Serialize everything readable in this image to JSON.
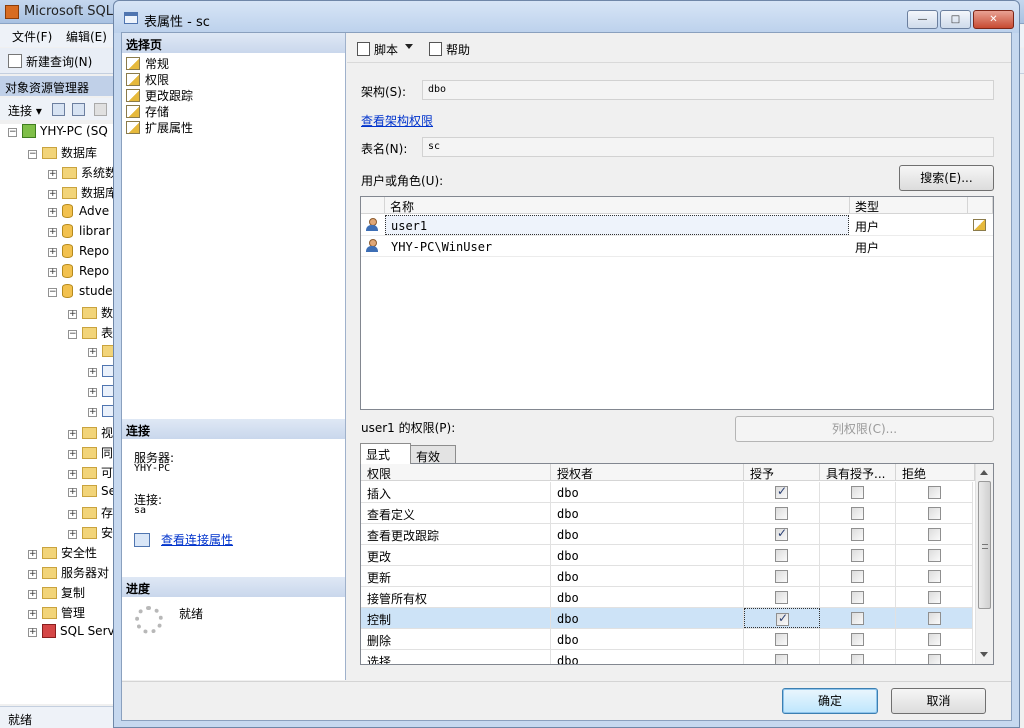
{
  "background_app": {
    "title": "Microsoft SQL",
    "menu": [
      "文件(F)",
      "编辑(E)"
    ],
    "toolbar_new_query": "新建查询(N)",
    "object_explorer_title": "对象资源管理器",
    "connect_label": "连接",
    "tree": [
      {
        "label": "YHY-PC (SQ",
        "level": 0,
        "icon": "server",
        "expander": "−"
      },
      {
        "label": "数据库",
        "level": 1,
        "icon": "folder",
        "expander": "−"
      },
      {
        "label": "系统数",
        "level": 2,
        "icon": "folder",
        "expander": "+"
      },
      {
        "label": "数据库",
        "level": 2,
        "icon": "folder",
        "expander": "+"
      },
      {
        "label": "Adve",
        "level": 2,
        "icon": "db",
        "expander": "+"
      },
      {
        "label": "librar",
        "level": 2,
        "icon": "db",
        "expander": "+"
      },
      {
        "label": "Repo",
        "level": 2,
        "icon": "db",
        "expander": "+"
      },
      {
        "label": "Repo",
        "level": 2,
        "icon": "db",
        "expander": "+"
      },
      {
        "label": "stude",
        "level": 2,
        "icon": "db",
        "expander": "−"
      },
      {
        "label": "数",
        "level": 3,
        "icon": "folder",
        "expander": "+"
      },
      {
        "label": "表",
        "level": 3,
        "icon": "folder",
        "expander": "−"
      },
      {
        "label": "",
        "level": 4,
        "icon": "folder",
        "expander": "+"
      },
      {
        "label": "",
        "level": 4,
        "icon": "table",
        "expander": "+"
      },
      {
        "label": "",
        "level": 4,
        "icon": "table",
        "expander": "+"
      },
      {
        "label": "",
        "level": 4,
        "icon": "table",
        "expander": "+"
      },
      {
        "label": "视",
        "level": 3,
        "icon": "folder",
        "expander": "+"
      },
      {
        "label": "同",
        "level": 3,
        "icon": "folder",
        "expander": "+"
      },
      {
        "label": "可",
        "level": 3,
        "icon": "folder",
        "expander": "+"
      },
      {
        "label": "Se",
        "level": 3,
        "icon": "folder",
        "expander": "+"
      },
      {
        "label": "存",
        "level": 3,
        "icon": "folder",
        "expander": "+"
      },
      {
        "label": "安",
        "level": 3,
        "icon": "folder",
        "expander": "+"
      },
      {
        "label": "安全性",
        "level": 1,
        "icon": "folder",
        "expander": "+"
      },
      {
        "label": "服务器对",
        "level": 1,
        "icon": "folder",
        "expander": "+"
      },
      {
        "label": "复制",
        "level": 1,
        "icon": "folder",
        "expander": "+"
      },
      {
        "label": "管理",
        "level": 1,
        "icon": "folder",
        "expander": "+"
      },
      {
        "label": "SQL Serv",
        "level": 1,
        "icon": "server-red",
        "expander": "+"
      }
    ],
    "status": "就绪"
  },
  "dialog": {
    "title": "表属性 - sc",
    "window_buttons": {
      "minimize": "—",
      "maximize": "□",
      "close": "✕"
    },
    "select_page_header": "选择页",
    "pages": [
      "常规",
      "权限",
      "更改跟踪",
      "存储",
      "扩展属性"
    ],
    "connection_header": "连接",
    "server_label": "服务器:",
    "server_value": "YHY-PC",
    "connection_label": "连接:",
    "connection_value": "sa",
    "view_connection_link": "查看连接属性",
    "progress_header": "进度",
    "progress_status": "就绪",
    "toolbar": {
      "script": "脚本",
      "help": "帮助"
    },
    "schema_label": "架构(S):",
    "schema_value": "dbo",
    "view_schema_link": "查看架构权限",
    "table_name_label": "表名(N):",
    "table_name_value": "sc",
    "users_roles_label": "用户或角色(U):",
    "search_button": "搜索(E)...",
    "users_columns": [
      "名称",
      "类型"
    ],
    "users": [
      {
        "name": "user1",
        "type": "用户"
      },
      {
        "name": "YHY-PC\\WinUser",
        "type": "用户"
      }
    ],
    "permissions_for_label": "user1 的权限(P):",
    "column_permissions_button": "列权限(C)...",
    "tabs": [
      "显式",
      "有效"
    ],
    "perm_columns": [
      "权限",
      "授权者",
      "授予",
      "具有授予...",
      "拒绝"
    ],
    "permissions": [
      {
        "permission": "插入",
        "grantor": "dbo",
        "grant": true,
        "with_grant": false,
        "deny": false
      },
      {
        "permission": "查看定义",
        "grantor": "dbo",
        "grant": false,
        "with_grant": false,
        "deny": false
      },
      {
        "permission": "查看更改跟踪",
        "grantor": "dbo",
        "grant": true,
        "with_grant": false,
        "deny": false
      },
      {
        "permission": "更改",
        "grantor": "dbo",
        "grant": false,
        "with_grant": false,
        "deny": false
      },
      {
        "permission": "更新",
        "grantor": "dbo",
        "grant": false,
        "with_grant": false,
        "deny": false
      },
      {
        "permission": "接管所有权",
        "grantor": "dbo",
        "grant": false,
        "with_grant": false,
        "deny": false
      },
      {
        "permission": "控制",
        "grantor": "dbo",
        "grant": true,
        "with_grant": false,
        "deny": false
      },
      {
        "permission": "删除",
        "grantor": "dbo",
        "grant": false,
        "with_grant": false,
        "deny": false
      },
      {
        "permission": "选择",
        "grantor": "dbo",
        "grant": false,
        "with_grant": false,
        "deny": false
      }
    ],
    "selected_permission_row": 6,
    "ok_button": "确定",
    "cancel_button": "取消"
  },
  "colors": {
    "link": "#0033cc",
    "selection": "#cde3f7",
    "title_bar": "#bcd1ec"
  }
}
